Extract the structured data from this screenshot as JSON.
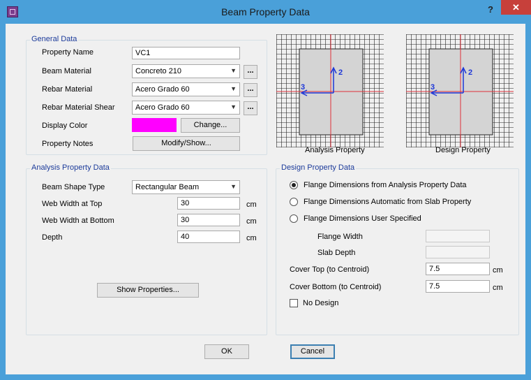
{
  "window": {
    "title": "Beam Property Data",
    "help_label": "?",
    "close_label": "✕"
  },
  "general": {
    "legend": "General Data",
    "property_name_label": "Property Name",
    "property_name_value": "VC1",
    "beam_material_label": "Beam Material",
    "beam_material_value": "Concreto 210",
    "rebar_material_label": "Rebar Material",
    "rebar_material_value": "Acero Grado 60",
    "rebar_shear_label": "Rebar Material Shear",
    "rebar_shear_value": "Acero Grado 60",
    "display_color_label": "Display Color",
    "display_color_value": "#ff00ff",
    "change_button": "Change...",
    "property_notes_label": "Property Notes",
    "modify_show_button": "Modify/Show...",
    "dots_label": "..."
  },
  "diagrams": {
    "analysis_caption": "Analysis Property",
    "design_caption": "Design Property",
    "axis2_label": "2",
    "axis3_label": "3"
  },
  "analysis": {
    "legend": "Analysis Property Data",
    "shape_label": "Beam Shape Type",
    "shape_value": "Rectangular Beam",
    "web_top_label": "Web Width at Top",
    "web_top_value": "30",
    "web_bottom_label": "Web Width at Bottom",
    "web_bottom_value": "30",
    "depth_label": "Depth",
    "depth_value": "40",
    "unit": "cm",
    "show_properties_button": "Show Properties..."
  },
  "design": {
    "legend": "Design Property  Data",
    "option1": "Flange Dimensions from Analysis Property Data",
    "option2": "Flange Dimensions Automatic from Slab Property",
    "option3": "Flange Dimensions User Specified",
    "selected_option": 1,
    "flange_width_label": "Flange Width",
    "slab_depth_label": "Slab Depth",
    "cover_top_label": "Cover Top (to Centroid)",
    "cover_top_value": "7.5",
    "cover_bottom_label": "Cover Bottom (to Centroid)",
    "cover_bottom_value": "7.5",
    "unit": "cm",
    "no_design_label": "No Design",
    "no_design_checked": false
  },
  "footer": {
    "ok_button": "OK",
    "cancel_button": "Cancel"
  }
}
